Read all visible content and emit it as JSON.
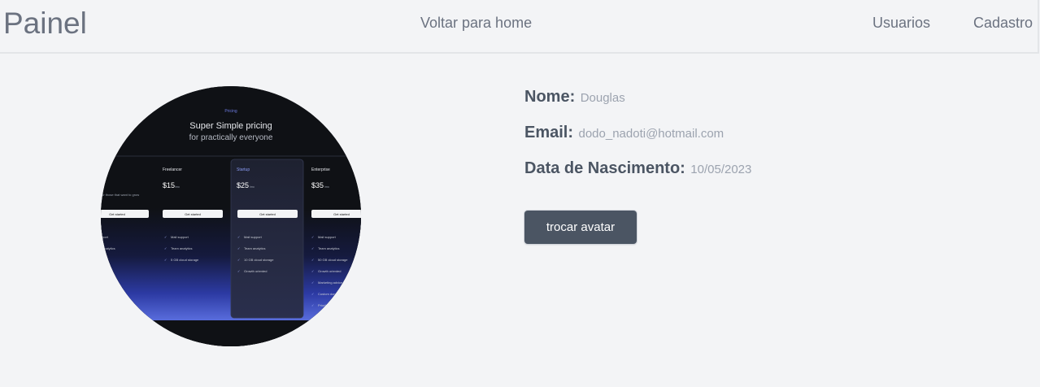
{
  "nav": {
    "brand": "Painel",
    "home_link": "Voltar para home",
    "users_link": "Usuarios",
    "register_link": "Cadastro"
  },
  "profile": {
    "name_label": "Nome:",
    "name_value": "Douglas",
    "email_label": "Email:",
    "email_value": "dodo_nadoti@hotmail.com",
    "birth_label": "Data de Nascimento:",
    "birth_value": "10/05/2023",
    "change_avatar_button": "trocar avatar"
  },
  "avatar_image": {
    "eyebrow": "Pricing",
    "headline": "Super Simple pricing",
    "subheadline": "for practically everyone",
    "plans": [
      {
        "name": "Freelancer",
        "price": "$15",
        "period": "/mo",
        "cta": "Get started",
        "features": [
          "Mail support",
          "Team analytics",
          "5 GB cloud storage"
        ]
      },
      {
        "name": "Startup",
        "price": "$25",
        "period": "/mo",
        "cta": "Get started",
        "features": [
          "Mail support",
          "Team analytics",
          "10 GB cloud storage",
          "Growth oriented"
        ]
      },
      {
        "name": "Enterprise",
        "price": "$35",
        "period": "/mo",
        "cta": "Get started",
        "features": [
          "Mail support",
          "Team analytics",
          "50 GB cloud storage",
          "Growth oriented",
          "Marketing advice",
          "Custom domains",
          "Priority support"
        ]
      }
    ],
    "partial_cta": "Get started",
    "partial_desc": "for those that want to grow",
    "partial_features": [
      "port",
      "analytics"
    ]
  }
}
